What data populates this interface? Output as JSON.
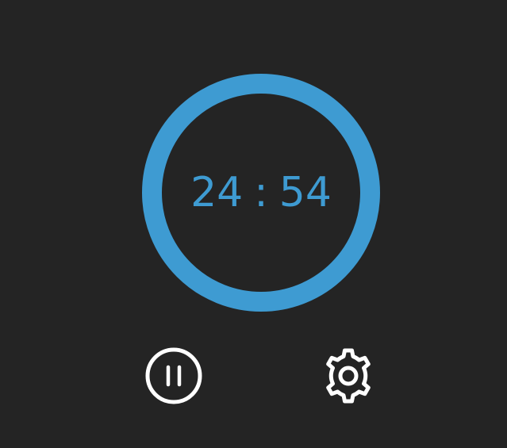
{
  "timer": {
    "minutes": "24",
    "separator": ":",
    "seconds": "54",
    "progress": 1.0,
    "ring_color": "#3e9bd2"
  },
  "controls": {
    "pause_icon": "pause-circle-icon",
    "settings_icon": "gear-icon"
  },
  "colors": {
    "background": "#242424",
    "accent": "#3e9bd2",
    "icon": "#ffffff"
  }
}
